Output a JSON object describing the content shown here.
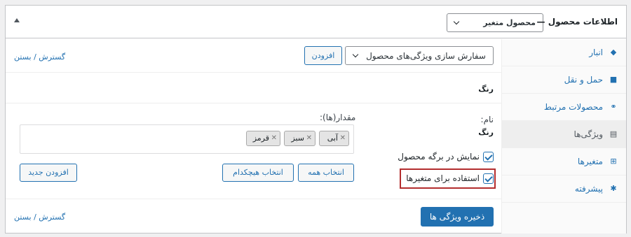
{
  "header": {
    "title": "اطلاعات محصول —",
    "product_type": "محصول متغیر",
    "collapse_icon": "triangle-up-icon"
  },
  "tabs": [
    {
      "label": "انبار",
      "icon": "tag-icon"
    },
    {
      "label": "حمل و نقل",
      "icon": "truck-icon"
    },
    {
      "label": "محصولات مرتبط",
      "icon": "link-icon"
    },
    {
      "label": "ویژگی‌ها",
      "icon": "list-icon",
      "active": true
    },
    {
      "label": "متغیرها",
      "icon": "grid-icon"
    },
    {
      "label": "پیشرفته",
      "icon": "gear-icon"
    }
  ],
  "toolbar": {
    "attribute_select": "سفارش سازی ویژگی‌های محصول",
    "add_button": "افزودن",
    "expand_collapse_top": "گسترش / بستن"
  },
  "attribute": {
    "title": "رنگ",
    "name_label": "نام:",
    "name_value": "رنگ",
    "values_label": "مقدار(ها):",
    "values": [
      "آبی",
      "سبز",
      "قرمز"
    ],
    "visible_on_product_page": "نمایش در برگه محصول",
    "used_for_variations": "استفاده برای متغیرها",
    "select_all": "انتخاب همه",
    "select_none": "انتخاب هیچکدام",
    "add_new": "افزودن جدید"
  },
  "footer": {
    "save_button": "ذخیره ویژگی ها",
    "expand_collapse_bottom": "گسترش / بستن"
  }
}
